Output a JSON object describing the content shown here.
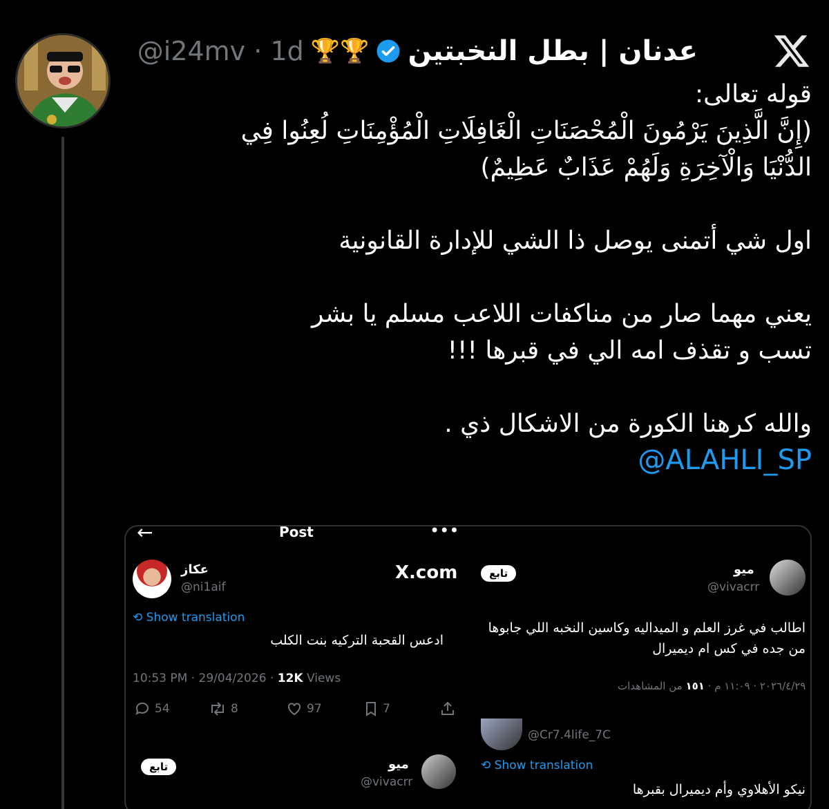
{
  "tweet": {
    "display_name": "عدنان | بطل النخبتين",
    "trophies": "🏆🏆",
    "handle": "@i24mv",
    "separator": "·",
    "time": "1d",
    "body": {
      "line1": "قوله تعالى:",
      "line2": "(إِنَّ الَّذِينَ يَرْمُونَ الْمُحْصَنَاتِ الْغَافِلَاتِ الْمُؤْمِنَاتِ لُعِنُوا فِي",
      "line3": "الدُّنْيَا وَالْآخِرَةِ وَلَهُمْ عَذَابٌ عَظِيمٌ)",
      "line4": "اول شي أتمنى يوصل ذا الشي للإدارة القانونية",
      "line5": "يعني مهما صار من مناكفات اللاعب مسلم يا بشر",
      "line6": "تسب و تقذف امه الي في قبرها !!!",
      "line7": "والله كرهنا الكورة من الاشكال ذي .",
      "mention": "@ALAHLI_SP"
    }
  },
  "media": {
    "header_title": "Post",
    "x_com": "X.com",
    "left_post": {
      "name": "عكاز",
      "handle": "@ni1aif",
      "show_translation": "Show translation",
      "text": "ادعس القحبة التركيه بنت الكلب",
      "timestamp": "10:53 PM · 29/04/2026 · ",
      "views_count": "12K",
      "views_label": " Views",
      "replies": "54",
      "reposts": "8",
      "likes": "97",
      "bookmarks": "7"
    },
    "right_post": {
      "name": "ميو",
      "handle": "@vivacrr",
      "follow": "تابع",
      "text_line1": "اطالب في غرز العلم و الميداليه وكاسين النخبه اللي جابوها",
      "text_line2": "من جده في كس ام ديميرال",
      "meta": "٢٠٢٦/٤/٢٩ · ١١:٠٩ م · ",
      "meta_count": "١٥١",
      "meta_label": " من المشاهدات"
    },
    "bottom_left_post": {
      "name": "ميو",
      "handle": "@vivacrr",
      "follow": "تابع"
    },
    "bottom_right_post": {
      "handle": "@Cr7.4life_7C",
      "show_translation": "Show translation",
      "text": "نيكو الأهلاوي وأم ديميرال بقبرها"
    }
  },
  "colors": {
    "background": "#000000",
    "text": "#e7e9ea",
    "secondary": "#71767b",
    "accent": "#1d9bf0",
    "verified": "#1d9bf0"
  }
}
